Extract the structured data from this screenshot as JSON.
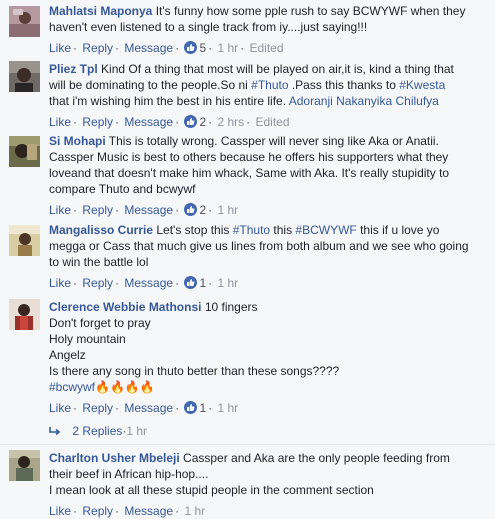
{
  "actions": {
    "like": "Like",
    "reply": "Reply",
    "message": "Message",
    "separator": "·"
  },
  "comments": [
    {
      "author": "Mahlatsi Maponya",
      "lines": [
        "It's funny how some pple rush to say BCWYWF when they",
        "haven't even listened to a single track from iy....just saying!!!"
      ],
      "likes": "5",
      "time": "1 hr",
      "edited": "Edited"
    },
    {
      "author": "Pliez Tpl",
      "line1": "Kind Of a thing that most will be played on air,it is, kind a thing that",
      "line2a": "will be dominating to the people.So ni ",
      "tag1": "#Thuto",
      "line2b": " .Pass this thanks to ",
      "tag2": "#Kwesta",
      "line3a": "that i'm wishing him the best in his entire life. ",
      "mention": "Adoranji Nakanyika Chilufya",
      "likes": "2",
      "time": "2 hrs",
      "edited": "Edited"
    },
    {
      "author": "Si Mohapi",
      "lines": [
        "This is totally wrong. Cassper will never sing like Aka or Anatii.",
        "Cassper Music is best to others because he offers his supporters what they",
        "loveand that doesn't make him whack, Same with Aka. It's really stupidity to",
        "compare Thuto and bcwywf"
      ],
      "likes": "2",
      "time": "1 hr"
    },
    {
      "author": "Mangalisso Currie",
      "l1a": "Let's stop this ",
      "tag1": "#Thuto",
      "l1b": " this ",
      "tag2": "#BCWYWF",
      "l1c": " this if u love yo",
      "lines": [
        "megga or Cass that much give us lines from both album and we see who going",
        "to win the battle lol"
      ],
      "likes": "1",
      "time": "1 hr"
    },
    {
      "author": "Clerence Webbie Mathonsi",
      "first": "10 fingers",
      "lines": [
        "Don't forget to pray",
        "Holy mountain",
        "Angelz",
        "Is there any song in thuto better than these songs????"
      ],
      "tag": "#bcwywf",
      "fire": "🔥🔥🔥🔥",
      "likes": "1",
      "time": "1 hr",
      "replies": "2 Replies",
      "replies_time": "1 hr"
    },
    {
      "author": "Charlton Usher Mbeleji",
      "lines": [
        "Cassper and Aka are the only people feeding from",
        "their beef in African hip-hop....",
        "I mean look at all these stupid people in the comment section"
      ],
      "time": "1 hr"
    }
  ]
}
